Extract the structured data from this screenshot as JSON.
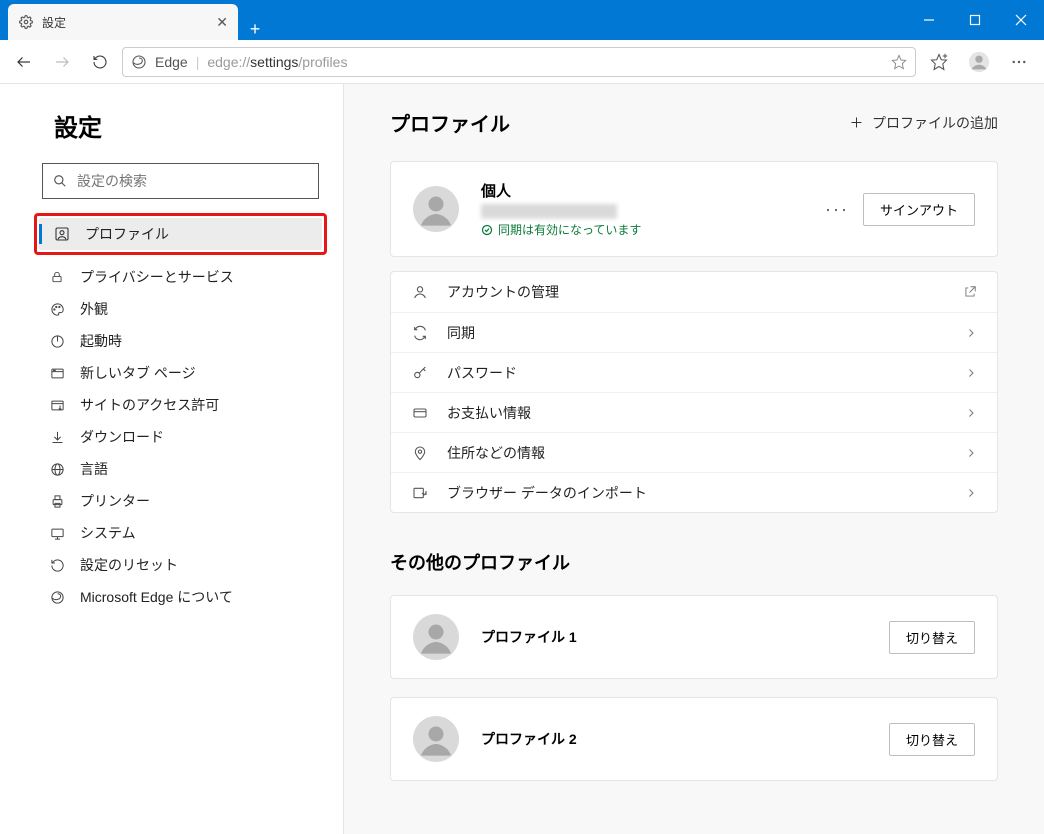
{
  "window": {
    "tab_title": "設定"
  },
  "toolbar": {
    "app_label": "Edge",
    "url_prefix": "edge://",
    "url_dark": "settings",
    "url_suffix": "/profiles"
  },
  "sidebar": {
    "title": "設定",
    "search_placeholder": "設定の検索",
    "items": [
      {
        "label": "プロファイル"
      },
      {
        "label": "プライバシーとサービス"
      },
      {
        "label": "外観"
      },
      {
        "label": "起動時"
      },
      {
        "label": "新しいタブ ページ"
      },
      {
        "label": "サイトのアクセス許可"
      },
      {
        "label": "ダウンロード"
      },
      {
        "label": "言語"
      },
      {
        "label": "プリンター"
      },
      {
        "label": "システム"
      },
      {
        "label": "設定のリセット"
      },
      {
        "label": "Microsoft Edge について"
      }
    ]
  },
  "main": {
    "header": "プロファイル",
    "add_profile_label": "プロファイルの追加",
    "profile": {
      "name": "個人",
      "sync_status": "同期は有効になっています",
      "signout_label": "サインアウト"
    },
    "menu": [
      {
        "label": "アカウントの管理",
        "action": "external"
      },
      {
        "label": "同期",
        "action": "chevron"
      },
      {
        "label": "パスワード",
        "action": "chevron"
      },
      {
        "label": "お支払い情報",
        "action": "chevron"
      },
      {
        "label": "住所などの情報",
        "action": "chevron"
      },
      {
        "label": "ブラウザー データのインポート",
        "action": "chevron"
      }
    ],
    "other_header": "その他のプロファイル",
    "other_profiles": [
      {
        "name": "プロファイル 1",
        "switch_label": "切り替え"
      },
      {
        "name": "プロファイル 2",
        "switch_label": "切り替え"
      }
    ]
  }
}
